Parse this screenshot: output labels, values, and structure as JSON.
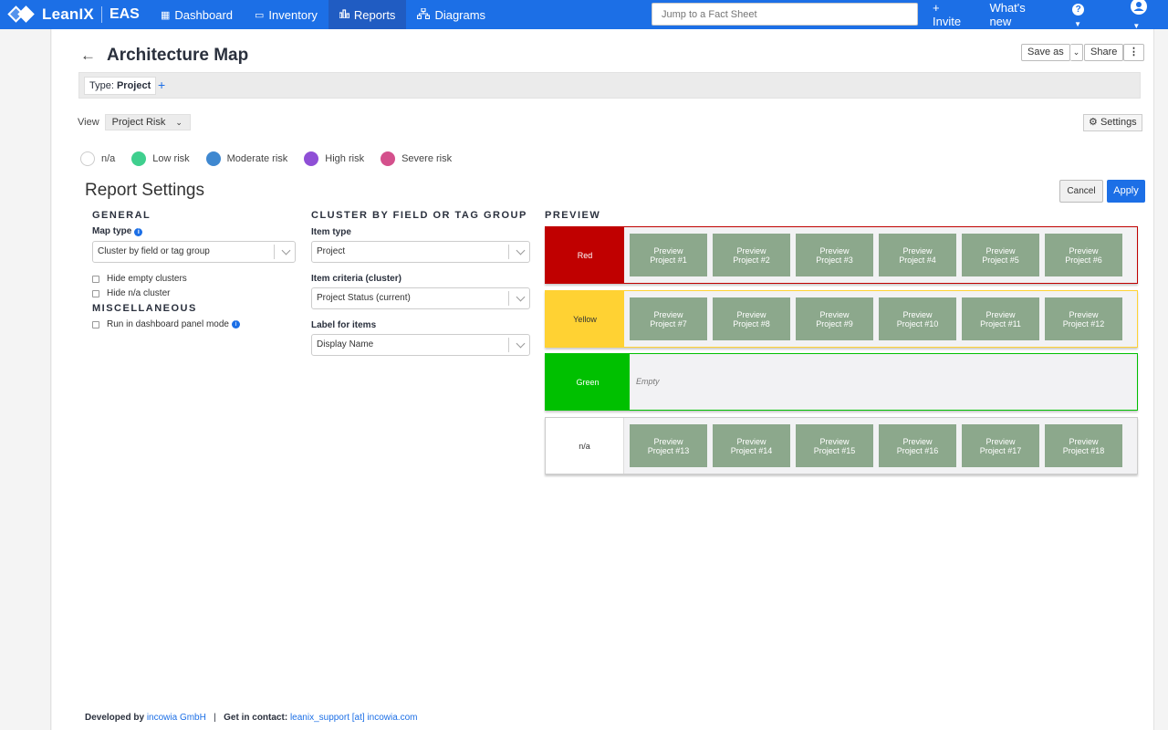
{
  "nav": {
    "brand": "LeanIX",
    "workspace": "EAS",
    "items": [
      {
        "label": "Dashboard",
        "icon": "grid-icon"
      },
      {
        "label": "Inventory",
        "icon": "inventory-icon"
      },
      {
        "label": "Reports",
        "icon": "bar-chart-icon",
        "active": true
      },
      {
        "label": "Diagrams",
        "icon": "sitemap-icon"
      }
    ],
    "search_placeholder": "Jump to a Fact Sheet",
    "invite": "+ Invite",
    "whats_new": "What's new"
  },
  "page": {
    "title": "Architecture Map",
    "save_as": "Save as",
    "share": "Share",
    "filter_type_label": "Type:",
    "filter_type_value": "Project",
    "view_label": "View",
    "view_value": "Project Risk",
    "settings": "Settings"
  },
  "legend": [
    {
      "label": "n/a",
      "color": "#ffffff"
    },
    {
      "label": "Low risk",
      "color": "#3fcf8e"
    },
    {
      "label": "Moderate risk",
      "color": "#3f88d0"
    },
    {
      "label": "High risk",
      "color": "#8f4fd6"
    },
    {
      "label": "Severe risk",
      "color": "#d4508c"
    }
  ],
  "report_settings": {
    "title": "Report Settings",
    "cancel": "Cancel",
    "apply": "Apply",
    "general": "GENERAL",
    "map_type_label": "Map type",
    "map_type_value": "Cluster by field or tag group",
    "hide_empty": "Hide empty clusters",
    "hide_na": "Hide n/a cluster",
    "misc": "MISCELLANEOUS",
    "dashboard_mode": "Run in dashboard panel mode",
    "cluster": "CLUSTER BY FIELD OR TAG GROUP",
    "item_type_label": "Item type",
    "item_type_value": "Project",
    "item_criteria_label": "Item criteria (cluster)",
    "item_criteria_value": "Project Status (current)",
    "label_items_label": "Label for items",
    "label_items_value": "Display Name",
    "preview": "PREVIEW"
  },
  "preview_rows": [
    {
      "label": "Red",
      "color": "#c00000",
      "text_color": "#ffffff",
      "border": "#c00000",
      "items": [
        "Preview Project #1",
        "Preview Project #2",
        "Preview Project #3",
        "Preview Project #4",
        "Preview Project #5",
        "Preview Project #6"
      ]
    },
    {
      "label": "Yellow",
      "color": "#ffd233",
      "text_color": "#333333",
      "border": "#ffd233",
      "items": [
        "Preview Project #7",
        "Preview Project #8",
        "Preview Project #9",
        "Preview Project #10",
        "Preview Project #11",
        "Preview Project #12"
      ]
    },
    {
      "label": "Green",
      "color": "#00c000",
      "text_color": "#ffffff",
      "border": "#00c000",
      "items": [],
      "empty": "Empty"
    },
    {
      "label": "n/a",
      "color": "#ffffff",
      "text_color": "#333333",
      "border": "#cccccc",
      "items": [
        "Preview Project #13",
        "Preview Project #14",
        "Preview Project #15",
        "Preview Project #16",
        "Preview Project #17",
        "Preview Project #18"
      ]
    }
  ],
  "footer": {
    "dev_prefix": "Developed by",
    "dev_company": "incowia GmbH",
    "sep": "|",
    "contact_prefix": "Get in contact:",
    "contact": "leanix_support [at] incowia.com"
  }
}
